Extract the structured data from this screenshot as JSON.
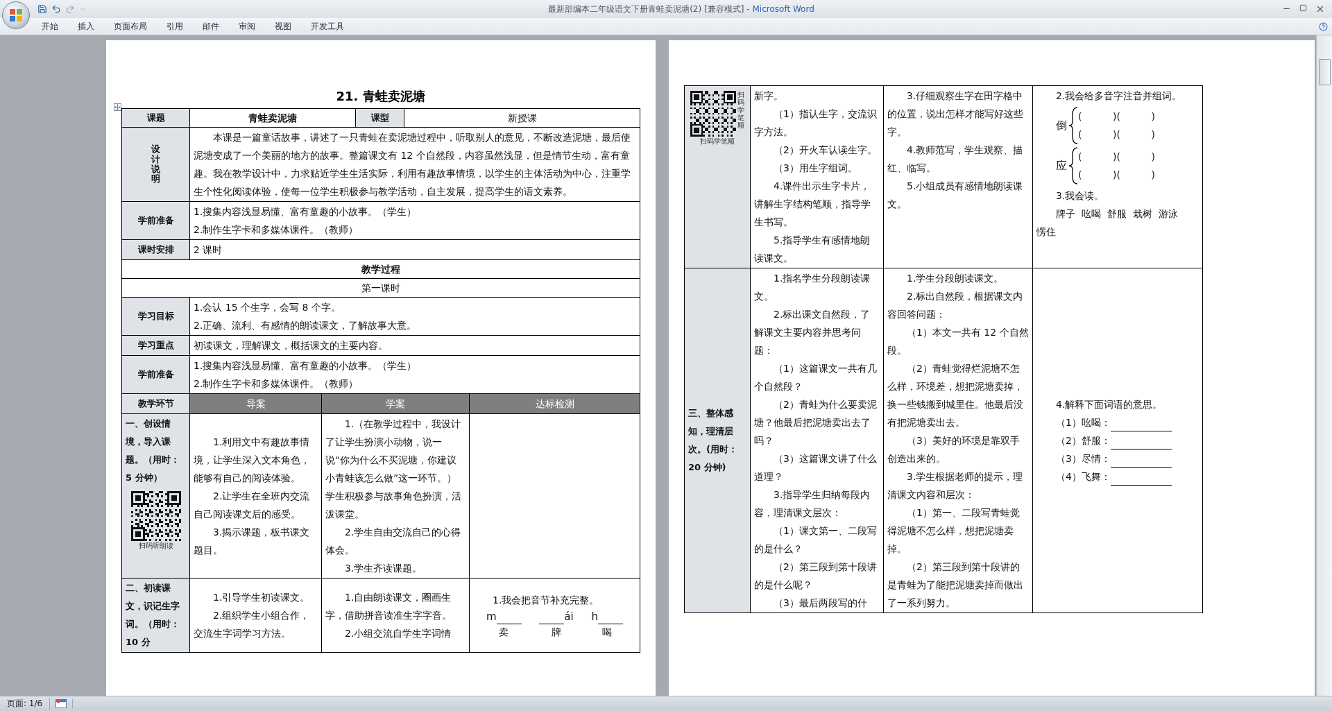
{
  "window": {
    "title": "最新部编本二年级语文下册青蛙卖泥塘(2) [兼容模式] -",
    "app_name": "Microsoft Word"
  },
  "ribbon_tabs": [
    "开始",
    "插入",
    "页面布局",
    "引用",
    "邮件",
    "审阅",
    "视图",
    "开发工具"
  ],
  "left_page": {
    "title": "21. 青蛙卖泥塘",
    "rows": [
      {
        "kind": "info",
        "cells": [
          {
            "kind": "label",
            "text": "课题"
          },
          {
            "kind": "title",
            "text": "青蛙卖泥塘"
          },
          {
            "kind": "label",
            "text": "课型"
          },
          {
            "kind": "value",
            "text": "新授课"
          }
        ]
      },
      {
        "kind": "field",
        "label": "设计说明",
        "label_vertical": true,
        "indented": true,
        "paragraphs": [
          "本课是一篇童话故事，讲述了一只青蛙在卖泥塘过程中，听取别人的意见，不断改造泥塘，最后使泥塘变成了一个美丽的地方的故事。整篇课文有 12 个自然段，内容虽然浅显，但是情节生动，富有童趣。我在教学设计中，力求贴近学生生活实际，利用有趣故事情境，以学生的主体活动为中心，注重学生个性化阅读体验，使每一位学生积极参与教学活动，自主发展，提高学生的语文素养。"
        ]
      },
      {
        "kind": "field",
        "label": "学前准备",
        "label_vertical": false,
        "indented": false,
        "paragraphs": [
          "1.搜集内容浅显易懂、富有童趣的小故事。（学生）",
          "2.制作生字卡和多媒体课件。（教师）"
        ]
      },
      {
        "kind": "field",
        "label": "课时安排",
        "label_vertical": false,
        "indented": false,
        "paragraphs": [
          "2 课时"
        ]
      },
      {
        "kind": "banner",
        "text": "教学过程",
        "bold": true
      },
      {
        "kind": "banner",
        "text": "第一课时",
        "bold": false
      },
      {
        "kind": "field",
        "label": "学习目标",
        "label_vertical": false,
        "indented": false,
        "paragraphs": [
          "1.会认 15 个生字，会写 8 个字。",
          "2.正确、流利、有感情的朗读课文，了解故事大意。"
        ]
      },
      {
        "kind": "field",
        "label": "学习重点",
        "label_vertical": false,
        "indented": false,
        "paragraphs": [
          "初读课文，理解课文，概括课文的主要内容。"
        ]
      },
      {
        "kind": "field",
        "label": "学前准备",
        "label_vertical": false,
        "indented": false,
        "paragraphs": [
          "1.搜集内容浅显易懂、富有童趣的小故事。（学生）",
          "2.制作生字卡和多媒体课件。（教师）"
        ]
      },
      {
        "kind": "header",
        "cells": [
          "教学环节",
          "导案",
          "学案",
          "达标检测"
        ]
      },
      {
        "kind": "step",
        "label": "一、创设情境，导入课题。（用时：5 分钟）",
        "qr_caption": "扫码听朗读",
        "columns": [
          {
            "blocks": [
              {
                "kind": "paragraph",
                "text": "1.利用文中有趣故事情境，让学生深入文本角色，能够有自己的阅读体验。"
              },
              {
                "kind": "paragraph",
                "text": "2.让学生在全班内交流自己阅读课文后的感受。"
              },
              {
                "kind": "paragraph",
                "text": "3.揭示课题，板书课文题目。"
              }
            ]
          },
          {
            "blocks": [
              {
                "kind": "paragraph",
                "text": "1.（在教学过程中，我设计了让学生扮演小动物，说一说“你为什么不买泥塘，你建议小青蛙该怎么做”这一环节。）学生积极参与故事角色扮演，活泼课堂。"
              },
              {
                "kind": "paragraph",
                "text": "2.学生自由交流自己的心得体会。"
              },
              {
                "kind": "paragraph",
                "text": "3.学生齐读课题。"
              }
            ]
          },
          {}
        ]
      },
      {
        "kind": "step",
        "label": "二、初读课文，识记生字词。（用时：10 分",
        "columns": [
          {
            "blocks": [
              {
                "kind": "paragraph",
                "text": "1.引导学生初读课文。"
              },
              {
                "kind": "paragraph",
                "text": "2.组织学生小组合作，交流生字词学习方法。"
              }
            ]
          },
          {
            "blocks": [
              {
                "kind": "paragraph",
                "text": "1.自由朗读课文，圈画生字，借助拼音读准生字字音。"
              },
              {
                "kind": "paragraph",
                "text": "2.小组交流自学生字词情"
              }
            ]
          },
          {
            "blocks": [
              {
                "kind": "paragraph",
                "text": "1.我会把音节补充完整。"
              },
              {
                "kind": "syllables",
                "items": [
                  {
                    "parts": [
                      {
                        "kind": "text",
                        "text": "m"
                      },
                      {
                        "kind": "blank"
                      }
                    ],
                    "char": "卖"
                  },
                  {
                    "parts": [
                      {
                        "kind": "blank"
                      },
                      {
                        "kind": "text",
                        "text": "ái"
                      }
                    ],
                    "char": "牌"
                  },
                  {
                    "parts": [
                      {
                        "kind": "text",
                        "text": "h"
                      },
                      {
                        "kind": "blank"
                      }
                    ],
                    "char": "喝"
                  }
                ]
              }
            ]
          }
        ]
      }
    ]
  },
  "right_page": {
    "rows": [
      {
        "kind": "continued",
        "qr_caption": "扫码学笔顺",
        "qr_side_caption": "扫码学笔顺",
        "columns": [
          {
            "blocks": [
              {
                "kind": "continuation",
                "text": "新字。"
              },
              {
                "kind": "paragraph",
                "text": "（1）指认生字，交流识字方法。"
              },
              {
                "kind": "paragraph",
                "text": "（2）开火车认读生字。"
              },
              {
                "kind": "paragraph",
                "text": "（3）用生字组词。"
              },
              {
                "kind": "paragraph",
                "text": "4.课件出示生字卡片，讲解生字结构笔顺，指导学生书写。"
              },
              {
                "kind": "paragraph",
                "text": "5.指导学生有感情地朗读课文。"
              }
            ]
          },
          {
            "blocks": [
              {
                "kind": "paragraph",
                "text": "3.仔细观察生字在田字格中的位置，说出怎样才能写好这些字。"
              },
              {
                "kind": "paragraph",
                "text": "4.教师范写，学生观察、描红、临写。"
              },
              {
                "kind": "paragraph",
                "text": "5.小组成员有感情地朗读课文。"
              }
            ]
          },
          {
            "blocks": [
              {
                "kind": "paragraph",
                "text": "2.我会给多音字注音并组词。"
              },
              {
                "kind": "polyphone",
                "char": "倒",
                "lines": [
                  "(          )(          )",
                  "(          )(          )"
                ]
              },
              {
                "kind": "polyphone",
                "char": "应",
                "lines": [
                  "(          )(          )",
                  "(          )(          )"
                ]
              },
              {
                "kind": "paragraph",
                "text": "3.我会读。"
              },
              {
                "kind": "words",
                "items": [
                  "牌子",
                  "吆喝",
                  "舒服",
                  "栽树",
                  "游泳",
                  "愣住"
                ]
              }
            ]
          }
        ]
      },
      {
        "kind": "step",
        "label": "三、整体感知，理清层次。(用时：20 分钟)",
        "columns": [
          {
            "blocks": [
              {
                "kind": "paragraph",
                "text": "1.指名学生分段朗读课文。"
              },
              {
                "kind": "paragraph",
                "text": "2.标出课文自然段，了解课文主要内容并思考问题："
              },
              {
                "kind": "paragraph",
                "text": "（1）这篇课文一共有几个自然段？"
              },
              {
                "kind": "paragraph",
                "text": "（2）青蛙为什么要卖泥塘？他最后把泥塘卖出去了吗？"
              },
              {
                "kind": "paragraph",
                "text": "（3）这篇课文讲了什么道理？"
              },
              {
                "kind": "paragraph",
                "text": "3.指导学生归纳每段内容，理清课文层次："
              },
              {
                "kind": "paragraph",
                "text": "（1）课文第一、二段写的是什么？"
              },
              {
                "kind": "paragraph",
                "text": "（2）第三段到第十段讲的是什么呢？"
              },
              {
                "kind": "paragraph",
                "text": "（3）最后两段写的什"
              }
            ]
          },
          {
            "blocks": [
              {
                "kind": "paragraph",
                "text": "1.学生分段朗读课文。"
              },
              {
                "kind": "paragraph",
                "text": "2.标出自然段，根据课文内容回答问题："
              },
              {
                "kind": "paragraph",
                "text": "（1）本文一共有 12 个自然段。"
              },
              {
                "kind": "paragraph",
                "text": "（2）青蛙觉得烂泥塘不怎么样，环境差，想把泥塘卖掉，换一些钱搬到城里住。他最后没有把泥塘卖出去。"
              },
              {
                "kind": "paragraph",
                "text": "（3）美好的环境是靠双手创造出来的。"
              },
              {
                "kind": "paragraph",
                "text": "3.学生根据老师的提示，理清课文内容和层次："
              },
              {
                "kind": "paragraph",
                "text": "（1）第一、二段写青蛙觉得泥塘不怎么样，想把泥塘卖掉。"
              },
              {
                "kind": "paragraph",
                "text": "（2）第三段到第十段讲的是青蛙为了能把泥塘卖掉而做出了一系列努力。"
              }
            ]
          },
          {
            "blocks": [
              {
                "kind": "paragraph",
                "text": "4.解释下面词语的意思。"
              },
              {
                "kind": "definition",
                "text": "（1）吆喝："
              },
              {
                "kind": "definition",
                "text": "（2）舒服："
              },
              {
                "kind": "definition",
                "text": "（3）尽情："
              },
              {
                "kind": "definition",
                "text": "（4）飞舞："
              }
            ]
          }
        ]
      }
    ]
  },
  "status_bar": {
    "page": "页面: 1/6"
  }
}
